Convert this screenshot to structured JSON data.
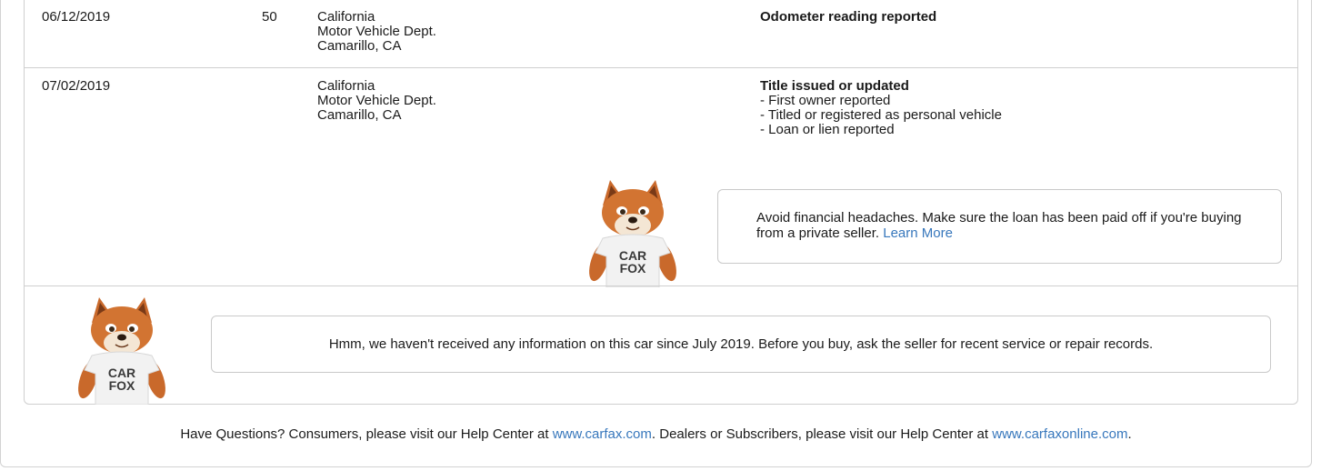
{
  "rows": [
    {
      "date": "06/12/2019",
      "mileage": "50",
      "source": [
        "California",
        "Motor Vehicle Dept.",
        "Camarillo, CA"
      ],
      "title": "Odometer reading reported",
      "details": []
    },
    {
      "date": "07/02/2019",
      "mileage": "",
      "source": [
        "California",
        "Motor Vehicle Dept.",
        "Camarillo, CA"
      ],
      "title": "Title issued or updated",
      "details": [
        "- First owner reported",
        "- Titled or registered as personal vehicle",
        "- Loan or lien reported"
      ]
    }
  ],
  "lien_tip": {
    "text": "Avoid financial headaches. Make sure the loan has been paid off if you're buying from a private seller.",
    "link": "Learn More"
  },
  "no_info_tip": {
    "text": "Hmm, we haven't received any information on this car since July 2019. Before you buy, ask the seller for recent service or repair records."
  },
  "fox_shirt": {
    "line1": "CAR",
    "line2": "FOX"
  },
  "footer": {
    "part1": "Have Questions? Consumers, please visit our Help Center at",
    "link1": "www.carfax.com",
    "part2": ". Dealers or Subscribers, please visit our Help Center at",
    "link2": "www.carfaxonline.com",
    "part3": "."
  },
  "colors": {
    "link": "#3777bc",
    "border": "#cfcfcf",
    "fox_orange": "#c9692b"
  }
}
